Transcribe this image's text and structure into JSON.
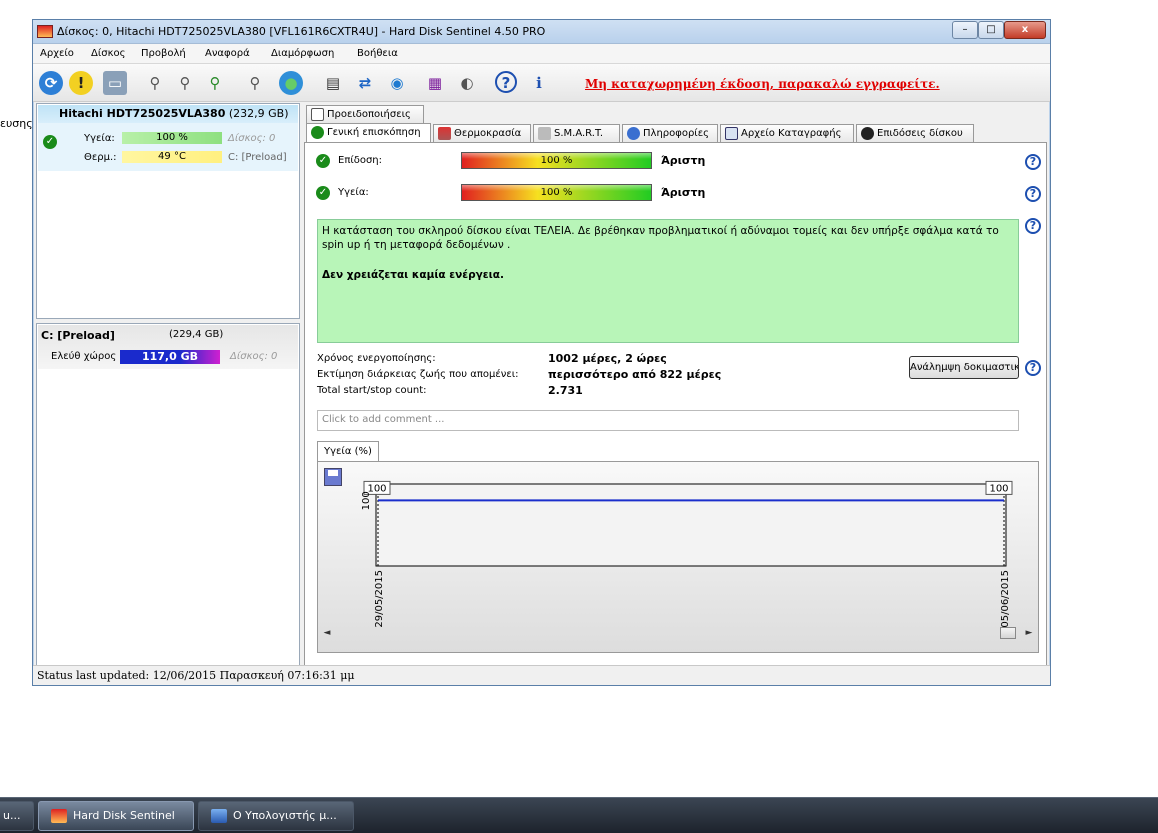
{
  "desktop": {
    "left_text": "ευσης"
  },
  "window": {
    "title": "Δίσκος: 0, Hitachi HDT725025VLA380 [VFL161R6CXTR4U]  -  Hard Disk Sentinel 4.50 PRO",
    "buttons": {
      "minimize": "–",
      "maximize": "□",
      "close": "x"
    }
  },
  "menu": [
    "Αρχείο",
    "Δίσκος",
    "Προβολή",
    "Αναφορά",
    "Διαμόρφωση",
    "Βοήθεια"
  ],
  "toolbar": {
    "icons": [
      "refresh-icon",
      "warning-icon",
      "disk-icon",
      "usb-disk-icon-1",
      "usb-disk-icon-2",
      "usb-disk-icon-3",
      "usb-disk-icon-4",
      "globe-icon",
      "document-icon",
      "sync-icon",
      "network-icon",
      "chart-icon",
      "speaker-icon",
      "help-icon",
      "info-icon"
    ],
    "register_link": "Μη καταχωρημένη έκδοση, παρακαλώ εγγραφείτε."
  },
  "left_panel": {
    "disk": {
      "name": "Hitachi HDT725025VLA380",
      "size": "(232,9 GB)",
      "health_label": "Υγεία:",
      "health_value": "100 %",
      "disk_label": "Δίσκος: 0",
      "temp_label": "Θερμ.:",
      "temp_value": "49 °C",
      "partition_ref": "C: [Preload]"
    },
    "partition": {
      "name": "C: [Preload]",
      "size": "(229,4 GB)",
      "free_label": "Ελεύθ χώρος",
      "free_value": "117,0 GB",
      "disk_label": "Δίσκος: 0"
    }
  },
  "tabs": {
    "top": "Προειδοποιήσεις",
    "main": [
      "Γενική επισκόπηση",
      "Θερμοκρασία",
      "S.M.A.R.T.",
      "Πληροφορίες",
      "Αρχείο Καταγραφής",
      "Επιδόσεις δίσκου"
    ]
  },
  "overview": {
    "performance_label": "Επίδοση:",
    "performance_value": "100 %",
    "performance_rating": "Άριστη",
    "performance_pct": 100,
    "health_label": "Υγεία:",
    "health_value": "100 %",
    "health_rating": "Άριστη",
    "health_pct": 100,
    "status_text": "Η κατάσταση του σκληρού δίσκου είναι ΤΕΛΕΙΑ. Δε βρέθηκαν προβληματικοί ή αδύναμοι τομείς και δεν υπήρξε σφάλμα κατά το spin up ή τη μεταφορά δεδομένων .",
    "status_action": "Δεν χρειάζεται καμία ενέργεια.",
    "power_on_label": "Χρόνος ενεργοποίησης:",
    "power_on_value": "1002 μέρες, 2 ώρες",
    "lifetime_label": "Εκτίμηση διάρκειας ζωής που απομένει:",
    "lifetime_value": "περισσότερο από 822 μέρες",
    "startstop_label": "Total start/stop count:",
    "startstop_value": "2.731",
    "test_button": "Ανάλημψη δοκιμαστικού",
    "comment_placeholder": "Click to add comment ..."
  },
  "chart_data": {
    "type": "line",
    "tab_label": "Υγεία (%)",
    "x": [
      "29/05/2015",
      "05/06/2015"
    ],
    "series": [
      {
        "values": [
          100,
          100
        ]
      }
    ],
    "y_tick_label": "100",
    "point_labels": [
      "100",
      "100"
    ],
    "color": "#1a2ecc"
  },
  "statusbar": "Status last updated: 12/06/2015 Παρασκευή 07:16:31 μμ",
  "taskbar": [
    {
      "label": "u..."
    },
    {
      "label": "Hard Disk Sentinel"
    },
    {
      "label": "Ο Υπολογιστής μ..."
    }
  ]
}
